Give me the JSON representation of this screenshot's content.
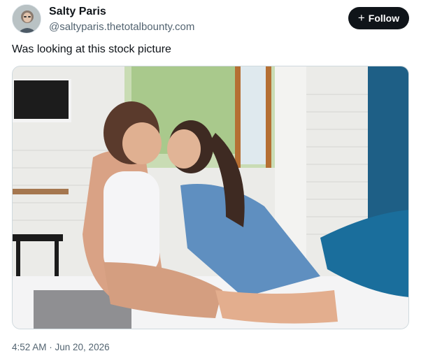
{
  "author": {
    "display_name": "Salty Paris",
    "handle": "@saltyparis.thetotalbounty.com",
    "avatar_icon": "profile-photo"
  },
  "follow": {
    "icon": "plus-icon",
    "icon_glyph": "+",
    "label": "Follow"
  },
  "post": {
    "text": "Was looking at this stock picture",
    "media_description_icon": "photo"
  },
  "meta": {
    "timestamp": "4:52 AM · Jun 20, 2026"
  },
  "colors": {
    "text_primary": "#0f1419",
    "text_secondary": "#536471",
    "button_bg": "#0f1419",
    "button_text": "#ffffff",
    "border": "#cfd9de"
  }
}
